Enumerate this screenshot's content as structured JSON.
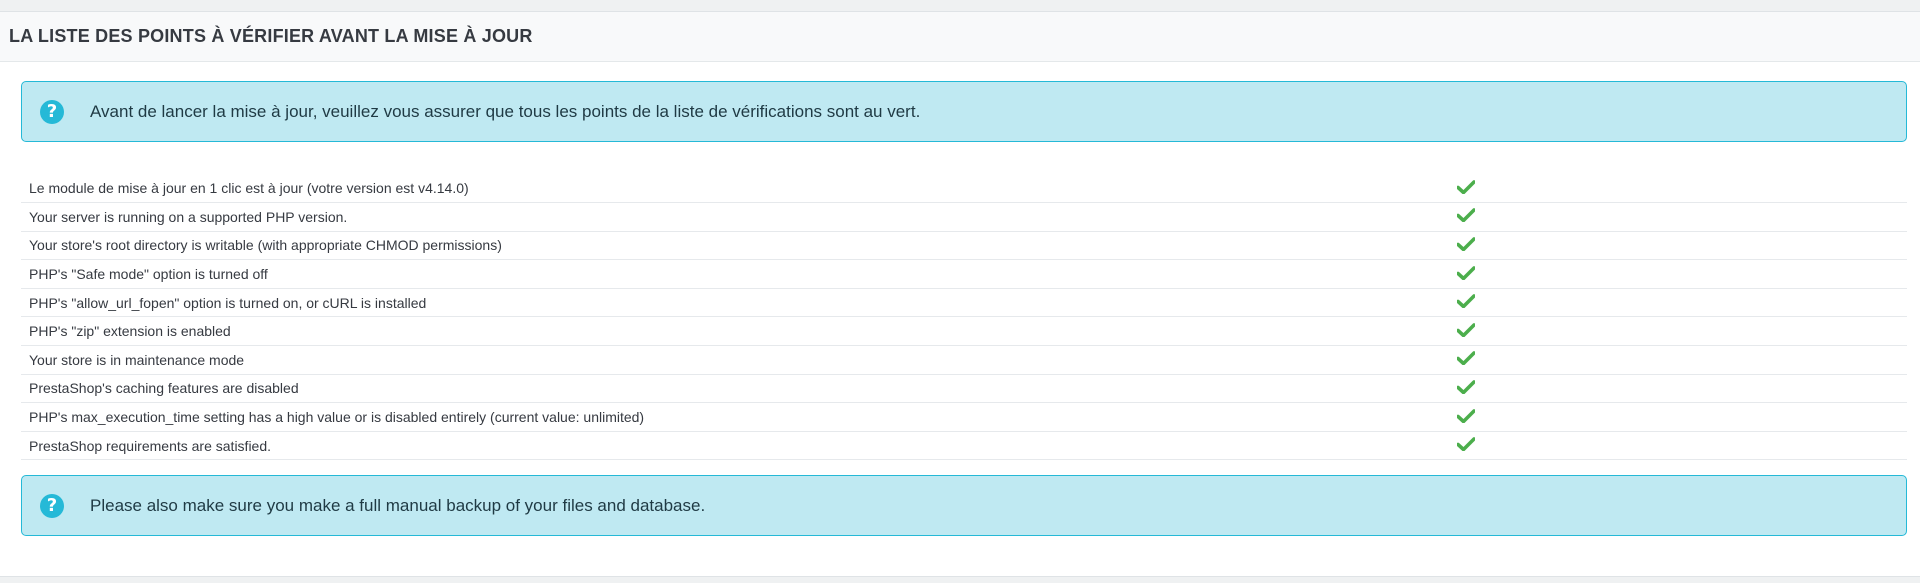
{
  "panel": {
    "title": "LA LISTE DES POINTS À VÉRIFIER AVANT LA MISE À JOUR"
  },
  "alerts": {
    "top": {
      "icon": "question-circle-icon",
      "text": "Avant de lancer la mise à jour, veuillez vous assurer que tous les points de la liste de vérifications sont au vert."
    },
    "bottom": {
      "icon": "question-circle-icon",
      "text": "Please also make sure you make a full manual backup of your files and database."
    }
  },
  "checklist": {
    "status_icon": "check-icon",
    "status_color": "#4cae4c",
    "items": [
      {
        "label": "Le module de mise à jour en 1 clic est à jour (votre version est v4.14.0)",
        "status": "ok"
      },
      {
        "label": "Your server is running on a supported PHP version.",
        "status": "ok"
      },
      {
        "label": "Your store's root directory is writable (with appropriate CHMOD permissions)",
        "status": "ok"
      },
      {
        "label": "PHP's \"Safe mode\" option is turned off",
        "status": "ok"
      },
      {
        "label": "PHP's \"allow_url_fopen\" option is turned on, or cURL is installed",
        "status": "ok"
      },
      {
        "label": "PHP's \"zip\" extension is enabled",
        "status": "ok"
      },
      {
        "label": "Your store is in maintenance mode",
        "status": "ok"
      },
      {
        "label": "PrestaShop's caching features are disabled",
        "status": "ok"
      },
      {
        "label": "PHP's max_execution_time setting has a high value or is disabled entirely (current value: unlimited)",
        "status": "ok"
      },
      {
        "label": "PrestaShop requirements are satisfied.",
        "status": "ok"
      }
    ]
  },
  "colors": {
    "alert_background": "#bfe9f2",
    "alert_border": "#25b9d7",
    "page_background": "#eff1f2"
  }
}
